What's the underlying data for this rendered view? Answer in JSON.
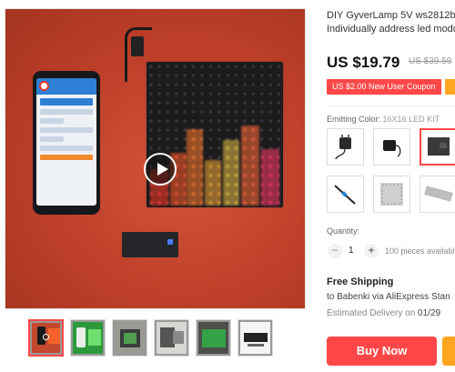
{
  "product": {
    "title_line1": "DIY GyverLamp 5V ws2812b M",
    "title_line2": "Individually address led modu",
    "price": "US $19.79",
    "old_price": "US $39.59",
    "coupon": "US $2.00 New User Coupon"
  },
  "sku": {
    "label": "Emitting Color:",
    "selected": "16X16 LED KIT"
  },
  "quantity": {
    "label": "Quantity:",
    "minus": "−",
    "value": "1",
    "plus": "+",
    "available": "100 pieces availabl"
  },
  "shipping": {
    "title": "Free Shipping",
    "via": "to Babenki via AliExpress Stan",
    "eta_label": "Estimated Delivery on",
    "eta_date": "01/29"
  },
  "actions": {
    "buy_now": "Buy Now"
  },
  "colors": {
    "accent": "#ff4747",
    "secondary": "#ffa51f"
  }
}
